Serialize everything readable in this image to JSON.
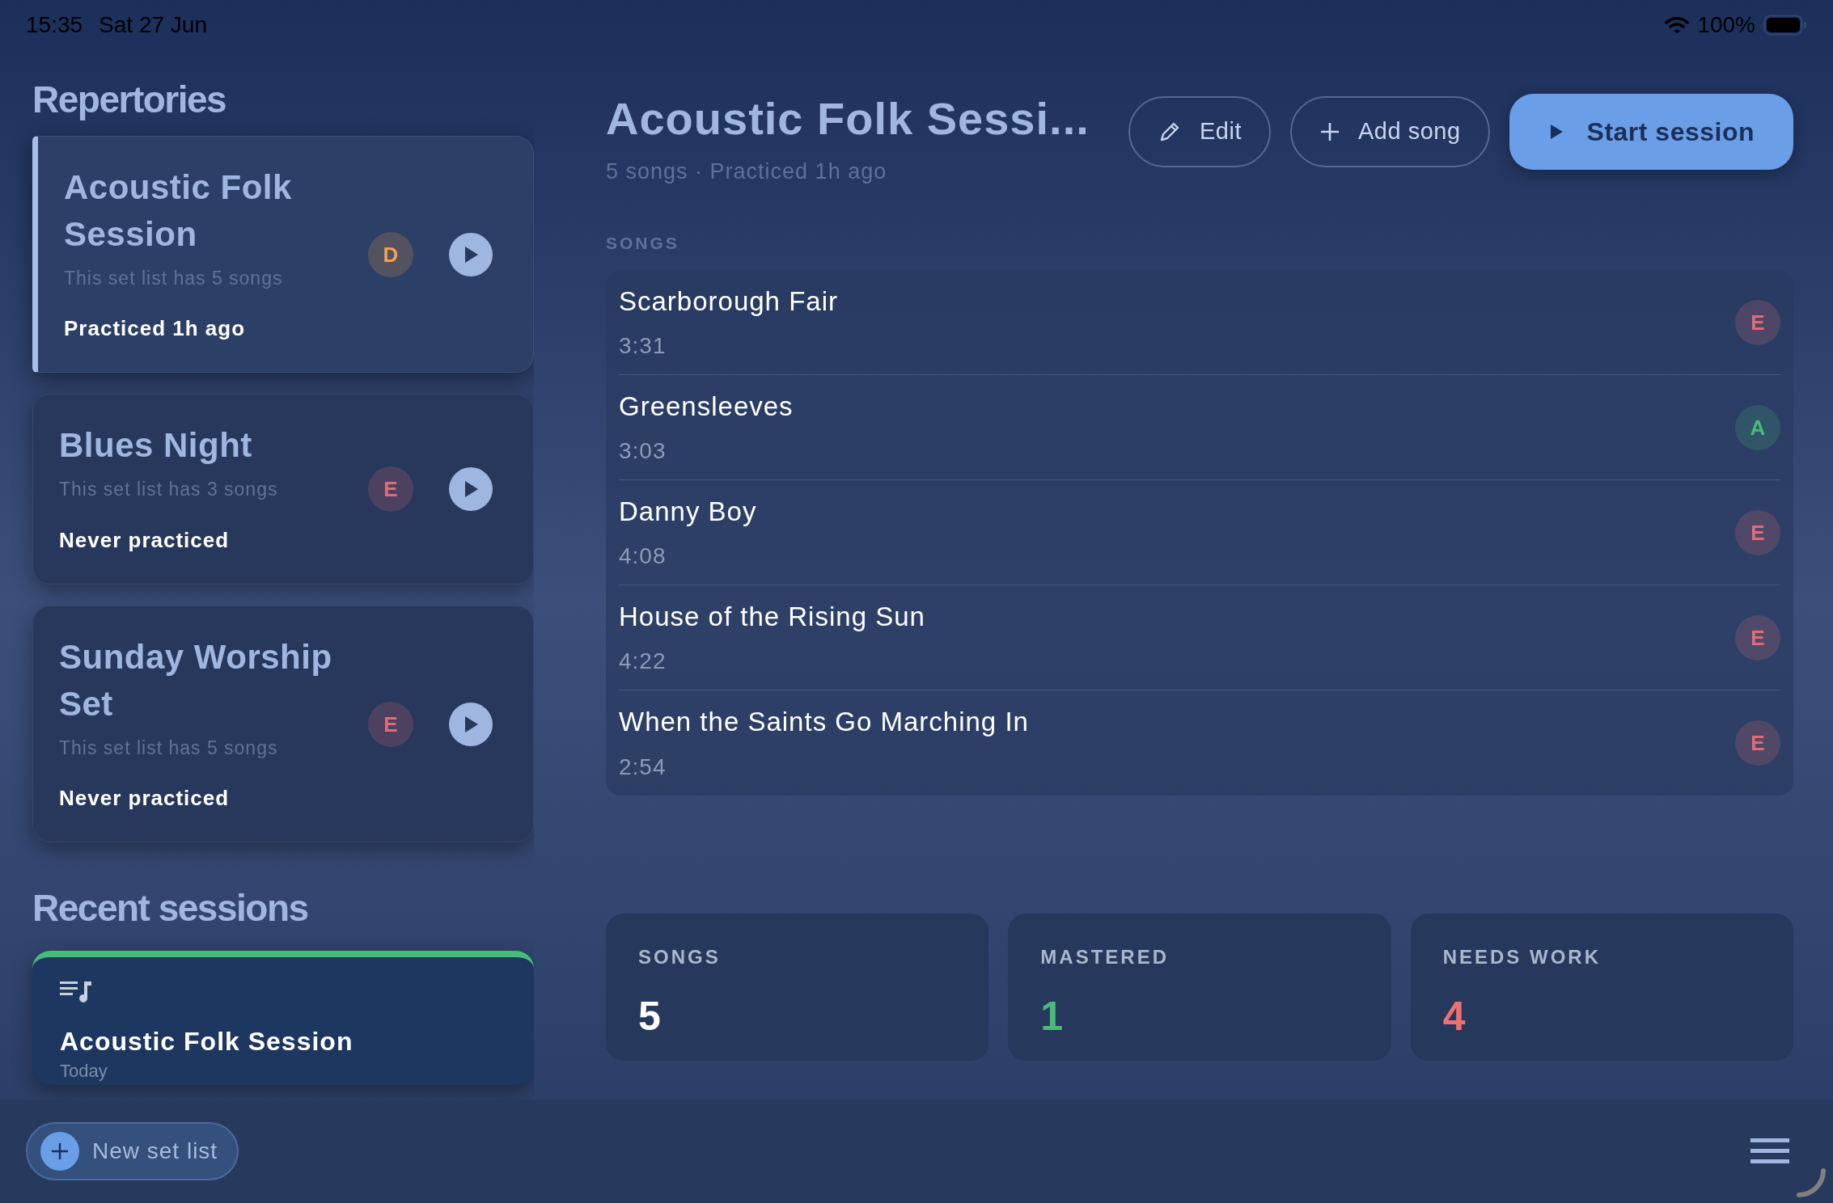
{
  "status_bar": {
    "time": "15:35",
    "date": "Sat 27 Jun",
    "battery": "100%"
  },
  "sidebar": {
    "title": "Repertories",
    "repertories": [
      {
        "title": "Acoustic Folk Session",
        "subtitle": "This set list has 5 songs",
        "practiced": "Practiced 1h ago",
        "grade": "D",
        "color": "#f0a050",
        "selected": true
      },
      {
        "title": "Blues Night",
        "subtitle": "This set list has 3 songs",
        "practiced": "Never practiced",
        "grade": "E",
        "color": "#e06c75",
        "selected": false
      },
      {
        "title": "Sunday Worship Set",
        "subtitle": "This set list has 5 songs",
        "practiced": "Never practiced",
        "grade": "E",
        "color": "#e06c75",
        "selected": false
      }
    ],
    "recent_title": "Recent sessions",
    "recent_sessions": [
      {
        "title": "Acoustic Folk Session",
        "when": "Today",
        "color": "#48bb78"
      }
    ]
  },
  "detail": {
    "title": "Acoustic Folk Sessi...",
    "subtitle": "5 songs · Practiced 1h ago",
    "buttons": [
      {
        "label": "Edit",
        "kind": "edit"
      },
      {
        "label": "Add song",
        "kind": "add"
      },
      {
        "label": "Start session",
        "kind": "primary"
      }
    ],
    "songs_label": "SONGS",
    "songs": [
      {
        "name": "Scarborough Fair",
        "duration": "3:31",
        "grade": "E",
        "color": "#e06c75"
      },
      {
        "name": "Greensleeves",
        "duration": "3:03",
        "grade": "A",
        "color": "#48bb78"
      },
      {
        "name": "Danny Boy",
        "duration": "4:08",
        "grade": "E",
        "color": "#e06c75"
      },
      {
        "name": "House of the Rising Sun",
        "duration": "4:22",
        "grade": "E",
        "color": "#e06c75"
      },
      {
        "name": "When the Saints Go Marching In",
        "duration": "2:54",
        "grade": "E",
        "color": "#e06c75"
      }
    ],
    "stats": [
      {
        "label": "SONGS",
        "value": "5",
        "color": "#ffffff"
      },
      {
        "label": "MASTERED",
        "value": "1",
        "color": "#48bb78"
      },
      {
        "label": "NEEDS WORK",
        "value": "4",
        "color": "#f07070"
      }
    ]
  },
  "bottom_bar": {
    "new_button": "New set list"
  }
}
